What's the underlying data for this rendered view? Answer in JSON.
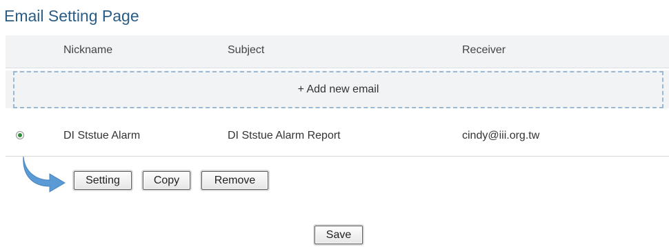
{
  "page": {
    "title": "Email Setting Page"
  },
  "table": {
    "columns": [
      "Nickname",
      "Subject",
      "Receiver"
    ],
    "add_label": "+ Add new email",
    "rows": [
      {
        "nickname": "DI Ststue Alarm",
        "subject": "DI Ststue Alarm Report",
        "receiver": "cindy@iii.org.tw",
        "selected": true
      }
    ]
  },
  "actions": {
    "setting": "Setting",
    "copy": "Copy",
    "remove": "Remove"
  },
  "footer": {
    "save": "Save"
  },
  "colors": {
    "title": "#2a5c86",
    "header_bg": "#f2f3f4",
    "dashed_border": "#9bb8d3",
    "arrow": "#5b9bd5",
    "radio_dot": "#2f8a3a"
  },
  "icons": {
    "arrow": "curved-arrow-icon",
    "radio": "radio-selected"
  }
}
